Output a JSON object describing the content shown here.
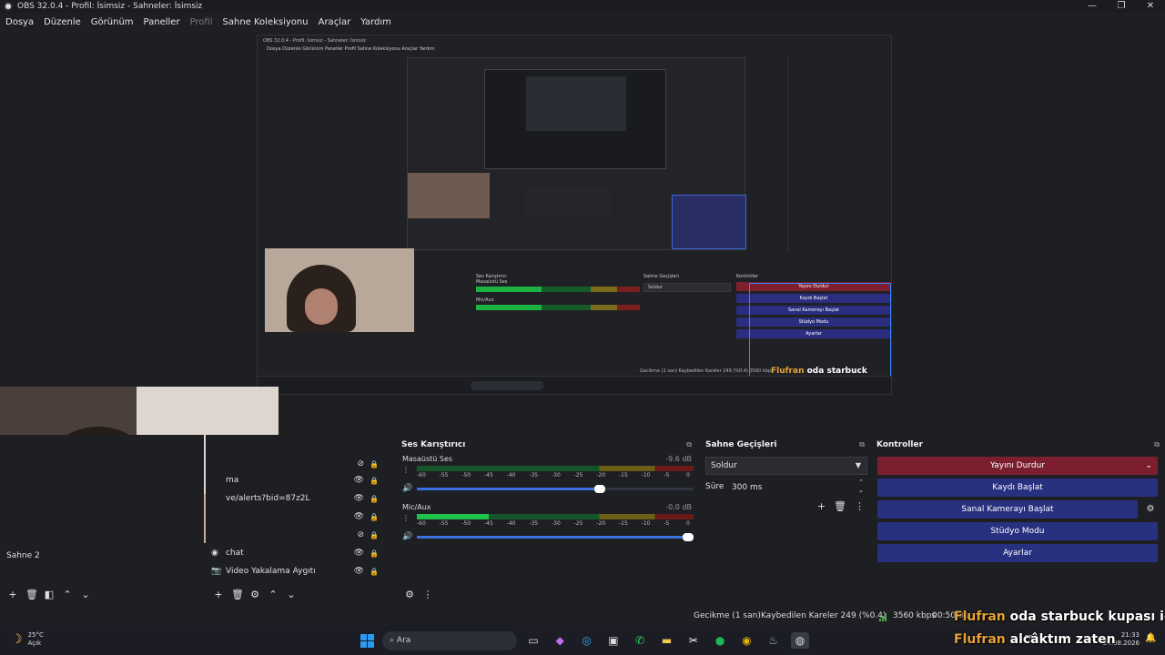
{
  "window": {
    "title": "OBS 32.0.4 - Profil: İsimsiz - Sahneler: İsimsiz",
    "minimize": "—",
    "maximize": "❐",
    "close": "✕"
  },
  "menu": {
    "items": [
      "Dosya",
      "Düzenle",
      "Görünüm",
      "Paneller",
      "Profil",
      "Sahne Koleksiyonu",
      "Araçlar",
      "Yardım"
    ]
  },
  "capture": {
    "title": "OBS 32.0.4 - Profil: İsimsiz - Sahneler: İsimsiz",
    "menu": "Dosya   Düzenle   Görünüm   Paneller   Profil   Sahne Koleksiyonu   Araçlar   Yardım",
    "mixer_title": "Ses Karıştırıcı",
    "mixer_ch1": "Masaüstü Ses",
    "mixer_ch2": "Mic/Aux",
    "trans_title": "Sahne Geçişleri",
    "trans_select": "Soldur",
    "ctrl_title": "Kontroller",
    "ctrl_buttons": [
      "Yayını Durdur",
      "Kaydı Başlat",
      "Sanal Kamerayı Başlat",
      "Stüdyo Modu",
      "Ayarlar"
    ],
    "status": "Gecikme (1 san)   Kaybedilen Kareler 249 (%0.4)   3560 kbps"
  },
  "docks": {
    "scenes": {
      "title": "",
      "item": "Sahne 2"
    },
    "sources": {
      "title": "",
      "items": [
        {
          "icon": "ma-icon",
          "name": "ma"
        },
        {
          "icon": "browser-icon",
          "name": "ve/alerts?bid=87z2L"
        },
        {
          "icon": "blank",
          "name": ""
        },
        {
          "icon": "blank",
          "name": ""
        },
        {
          "icon": "browser-icon",
          "name": "chat"
        },
        {
          "icon": "camera-icon",
          "name": "Video Yakalama Aygıtı"
        }
      ]
    },
    "mixer": {
      "title": "Ses Karıştırıcı",
      "channels": [
        {
          "name": "Masaüstü Ses",
          "db": "-9.6 dB",
          "level": 0.0,
          "volume": 0.66
        },
        {
          "name": "Mic/Aux",
          "db": "-0.0 dB",
          "level": 0.26,
          "volume": 1.0
        }
      ],
      "ticks": [
        "-60",
        "-55",
        "-50",
        "-45",
        "-40",
        "-35",
        "-30",
        "-25",
        "-20",
        "-15",
        "-10",
        "-5",
        "0"
      ]
    },
    "transitions": {
      "title": "Sahne Geçişleri",
      "selected": "Soldur",
      "duration_label": "Süre",
      "duration_value": "300 ms"
    },
    "controls": {
      "title": "Kontroller",
      "stop_stream": "Yayını Durdur",
      "start_record": "Kaydı Başlat",
      "start_virtualcam": "Sanal Kamerayı Başlat",
      "studio_mode": "Stüdyo Modu",
      "settings": "Ayarlar"
    }
  },
  "status": {
    "delay": "Gecikme (1 san)",
    "dropped": "Kaybedilen Kareler 249 (%0.4)",
    "bitrate": "3560 kbps",
    "time": "00:50:31"
  },
  "chat": {
    "line1_name": "Flufran",
    "line1_msg": "oda starbuck kupası idi",
    "line2_name": "Flufran",
    "line2_msg": "alcâktım zaten"
  },
  "taskbar": {
    "temp": "25°C",
    "condition": "Açık",
    "search_placeholder": "Ara",
    "lang": "TRQ",
    "time": "21:33",
    "date": "24.08.2026",
    "whatsapp_badge": "6"
  },
  "colors": {
    "stop_stream": "#7b1f2e",
    "control_button": "#283080",
    "accent_blue": "#3c6fe0",
    "chat_name": "#e8a23a"
  }
}
